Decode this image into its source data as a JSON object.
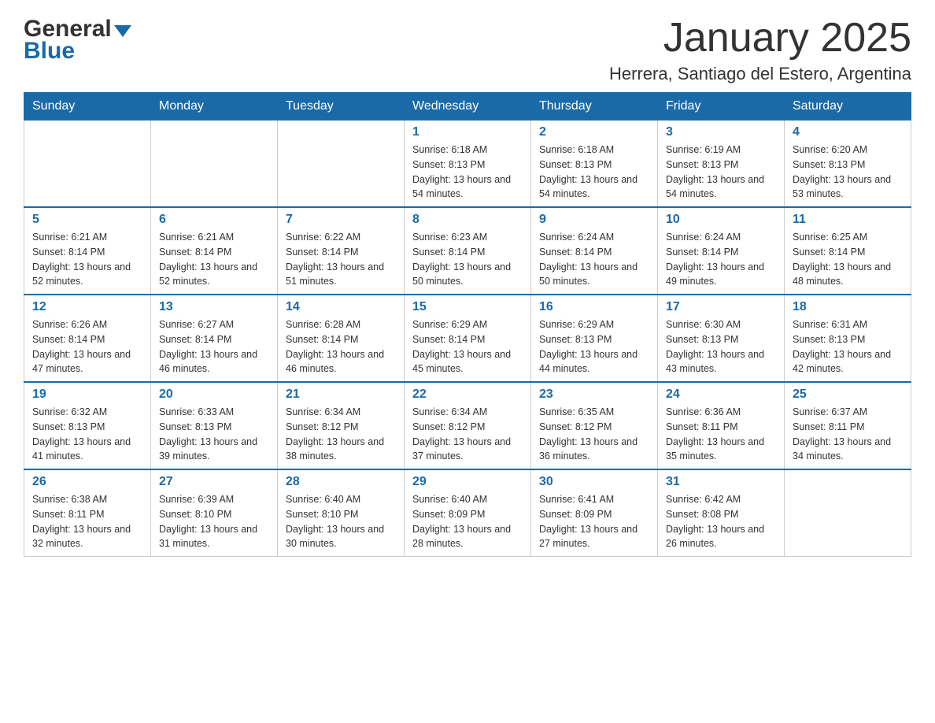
{
  "header": {
    "logo_general": "General",
    "logo_blue": "Blue",
    "month_title": "January 2025",
    "location": "Herrera, Santiago del Estero, Argentina"
  },
  "days_of_week": [
    "Sunday",
    "Monday",
    "Tuesday",
    "Wednesday",
    "Thursday",
    "Friday",
    "Saturday"
  ],
  "weeks": [
    [
      {
        "day": "",
        "sunrise": "",
        "sunset": "",
        "daylight": ""
      },
      {
        "day": "",
        "sunrise": "",
        "sunset": "",
        "daylight": ""
      },
      {
        "day": "",
        "sunrise": "",
        "sunset": "",
        "daylight": ""
      },
      {
        "day": "1",
        "sunrise": "Sunrise: 6:18 AM",
        "sunset": "Sunset: 8:13 PM",
        "daylight": "Daylight: 13 hours and 54 minutes."
      },
      {
        "day": "2",
        "sunrise": "Sunrise: 6:18 AM",
        "sunset": "Sunset: 8:13 PM",
        "daylight": "Daylight: 13 hours and 54 minutes."
      },
      {
        "day": "3",
        "sunrise": "Sunrise: 6:19 AM",
        "sunset": "Sunset: 8:13 PM",
        "daylight": "Daylight: 13 hours and 54 minutes."
      },
      {
        "day": "4",
        "sunrise": "Sunrise: 6:20 AM",
        "sunset": "Sunset: 8:13 PM",
        "daylight": "Daylight: 13 hours and 53 minutes."
      }
    ],
    [
      {
        "day": "5",
        "sunrise": "Sunrise: 6:21 AM",
        "sunset": "Sunset: 8:14 PM",
        "daylight": "Daylight: 13 hours and 52 minutes."
      },
      {
        "day": "6",
        "sunrise": "Sunrise: 6:21 AM",
        "sunset": "Sunset: 8:14 PM",
        "daylight": "Daylight: 13 hours and 52 minutes."
      },
      {
        "day": "7",
        "sunrise": "Sunrise: 6:22 AM",
        "sunset": "Sunset: 8:14 PM",
        "daylight": "Daylight: 13 hours and 51 minutes."
      },
      {
        "day": "8",
        "sunrise": "Sunrise: 6:23 AM",
        "sunset": "Sunset: 8:14 PM",
        "daylight": "Daylight: 13 hours and 50 minutes."
      },
      {
        "day": "9",
        "sunrise": "Sunrise: 6:24 AM",
        "sunset": "Sunset: 8:14 PM",
        "daylight": "Daylight: 13 hours and 50 minutes."
      },
      {
        "day": "10",
        "sunrise": "Sunrise: 6:24 AM",
        "sunset": "Sunset: 8:14 PM",
        "daylight": "Daylight: 13 hours and 49 minutes."
      },
      {
        "day": "11",
        "sunrise": "Sunrise: 6:25 AM",
        "sunset": "Sunset: 8:14 PM",
        "daylight": "Daylight: 13 hours and 48 minutes."
      }
    ],
    [
      {
        "day": "12",
        "sunrise": "Sunrise: 6:26 AM",
        "sunset": "Sunset: 8:14 PM",
        "daylight": "Daylight: 13 hours and 47 minutes."
      },
      {
        "day": "13",
        "sunrise": "Sunrise: 6:27 AM",
        "sunset": "Sunset: 8:14 PM",
        "daylight": "Daylight: 13 hours and 46 minutes."
      },
      {
        "day": "14",
        "sunrise": "Sunrise: 6:28 AM",
        "sunset": "Sunset: 8:14 PM",
        "daylight": "Daylight: 13 hours and 46 minutes."
      },
      {
        "day": "15",
        "sunrise": "Sunrise: 6:29 AM",
        "sunset": "Sunset: 8:14 PM",
        "daylight": "Daylight: 13 hours and 45 minutes."
      },
      {
        "day": "16",
        "sunrise": "Sunrise: 6:29 AM",
        "sunset": "Sunset: 8:13 PM",
        "daylight": "Daylight: 13 hours and 44 minutes."
      },
      {
        "day": "17",
        "sunrise": "Sunrise: 6:30 AM",
        "sunset": "Sunset: 8:13 PM",
        "daylight": "Daylight: 13 hours and 43 minutes."
      },
      {
        "day": "18",
        "sunrise": "Sunrise: 6:31 AM",
        "sunset": "Sunset: 8:13 PM",
        "daylight": "Daylight: 13 hours and 42 minutes."
      }
    ],
    [
      {
        "day": "19",
        "sunrise": "Sunrise: 6:32 AM",
        "sunset": "Sunset: 8:13 PM",
        "daylight": "Daylight: 13 hours and 41 minutes."
      },
      {
        "day": "20",
        "sunrise": "Sunrise: 6:33 AM",
        "sunset": "Sunset: 8:13 PM",
        "daylight": "Daylight: 13 hours and 39 minutes."
      },
      {
        "day": "21",
        "sunrise": "Sunrise: 6:34 AM",
        "sunset": "Sunset: 8:12 PM",
        "daylight": "Daylight: 13 hours and 38 minutes."
      },
      {
        "day": "22",
        "sunrise": "Sunrise: 6:34 AM",
        "sunset": "Sunset: 8:12 PM",
        "daylight": "Daylight: 13 hours and 37 minutes."
      },
      {
        "day": "23",
        "sunrise": "Sunrise: 6:35 AM",
        "sunset": "Sunset: 8:12 PM",
        "daylight": "Daylight: 13 hours and 36 minutes."
      },
      {
        "day": "24",
        "sunrise": "Sunrise: 6:36 AM",
        "sunset": "Sunset: 8:11 PM",
        "daylight": "Daylight: 13 hours and 35 minutes."
      },
      {
        "day": "25",
        "sunrise": "Sunrise: 6:37 AM",
        "sunset": "Sunset: 8:11 PM",
        "daylight": "Daylight: 13 hours and 34 minutes."
      }
    ],
    [
      {
        "day": "26",
        "sunrise": "Sunrise: 6:38 AM",
        "sunset": "Sunset: 8:11 PM",
        "daylight": "Daylight: 13 hours and 32 minutes."
      },
      {
        "day": "27",
        "sunrise": "Sunrise: 6:39 AM",
        "sunset": "Sunset: 8:10 PM",
        "daylight": "Daylight: 13 hours and 31 minutes."
      },
      {
        "day": "28",
        "sunrise": "Sunrise: 6:40 AM",
        "sunset": "Sunset: 8:10 PM",
        "daylight": "Daylight: 13 hours and 30 minutes."
      },
      {
        "day": "29",
        "sunrise": "Sunrise: 6:40 AM",
        "sunset": "Sunset: 8:09 PM",
        "daylight": "Daylight: 13 hours and 28 minutes."
      },
      {
        "day": "30",
        "sunrise": "Sunrise: 6:41 AM",
        "sunset": "Sunset: 8:09 PM",
        "daylight": "Daylight: 13 hours and 27 minutes."
      },
      {
        "day": "31",
        "sunrise": "Sunrise: 6:42 AM",
        "sunset": "Sunset: 8:08 PM",
        "daylight": "Daylight: 13 hours and 26 minutes."
      },
      {
        "day": "",
        "sunrise": "",
        "sunset": "",
        "daylight": ""
      }
    ]
  ]
}
